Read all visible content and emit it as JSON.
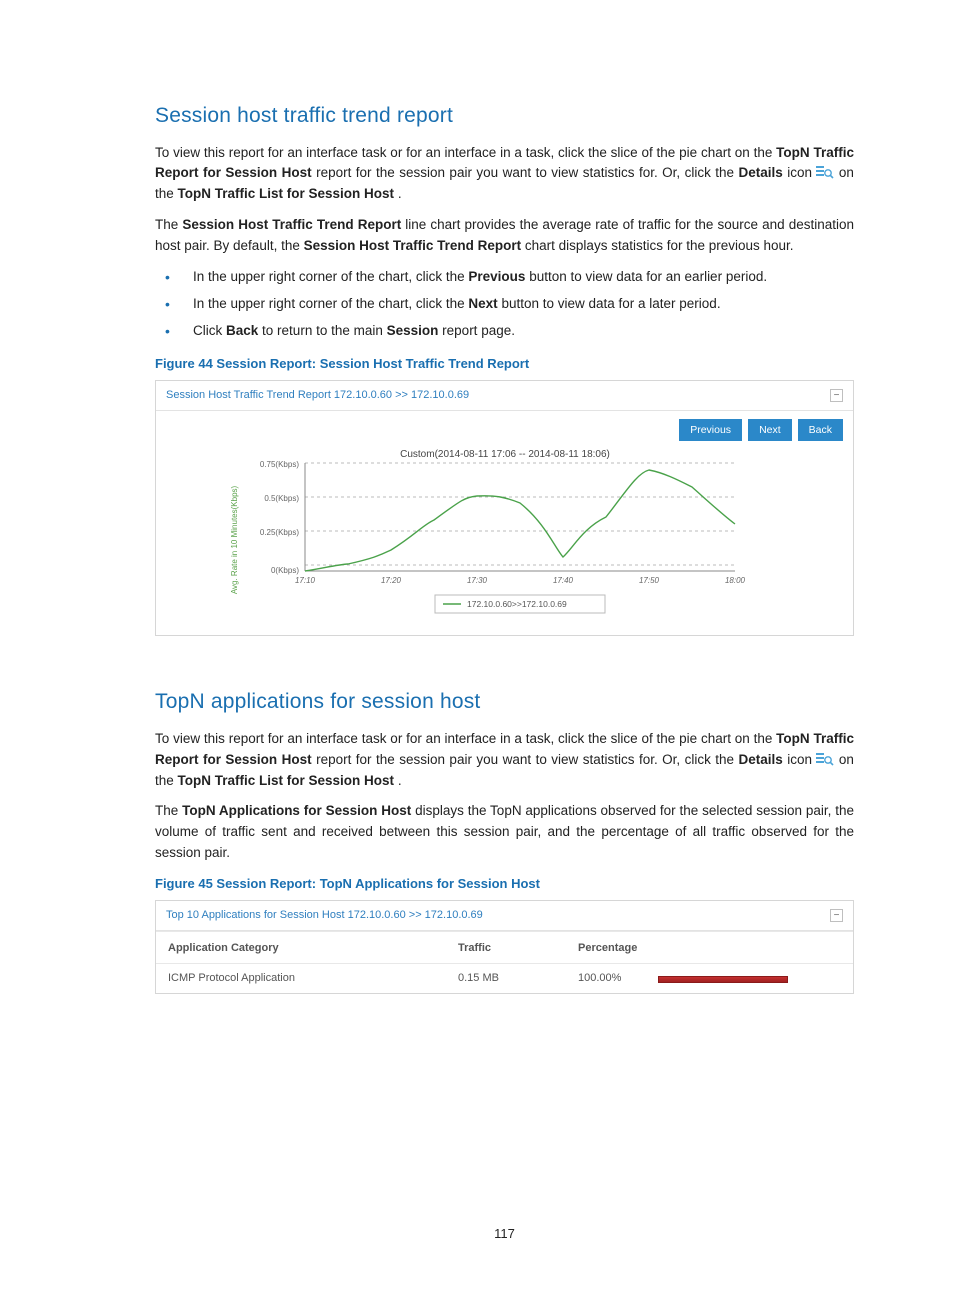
{
  "section1": {
    "heading": "Session host traffic trend report",
    "para1_parts": {
      "p1": "To view this report for an interface task or for an interface in a task, click the slice of the pie chart on the ",
      "b1": "TopN Traffic Report for Session Host",
      "p2": " report for the session pair you want to view statistics for. Or, click the ",
      "b2": "Details",
      "p3": " icon ",
      "p4": " on the ",
      "b3": "TopN Traffic List for Session Host",
      "p5": "."
    },
    "para2_parts": {
      "p1": "The ",
      "b1": "Session Host Traffic Trend Report",
      "p2": " line chart provides the average rate of traffic for the source and destination host pair. By default, the ",
      "b2": "Session Host Traffic Trend Report",
      "p3": " chart displays statistics for the previous hour."
    },
    "bullets": [
      {
        "pre": "In the upper right corner of the chart, click the ",
        "b": "Previous",
        "post": " button to view data for an earlier period."
      },
      {
        "pre": "In the upper right corner of the chart, click the ",
        "b": "Next",
        "post": " button to view data for a later period."
      },
      {
        "pre": "Click ",
        "b": "Back",
        "post": " to return to the main ",
        "b2": "Session",
        "post2": " report page."
      }
    ],
    "figure_caption": "Figure 44 Session Report: Session Host Traffic Trend Report"
  },
  "panel1": {
    "title": "Session Host Traffic Trend Report 172.10.0.60 >> 172.10.0.69",
    "buttons": {
      "previous": "Previous",
      "next": "Next",
      "back": "Back"
    },
    "chart_subtitle": "Custom(2014-08-11 17:06 -- 2014-08-11 18:06)",
    "legend": "172.10.0.60>>172.10.0.69",
    "y_axis_label": "Avg. Rate in 10 Minutes(Kbps)"
  },
  "chart_data": {
    "type": "line",
    "title": "Custom(2014-08-11 17:06 -- 2014-08-11 18:06)",
    "xlabel": "",
    "ylabel": "Avg. Rate in 10 Minutes(Kbps)",
    "ylim": [
      0,
      0.8
    ],
    "y_ticks": [
      "0(Kbps)",
      "0.25(Kbps)",
      "0.5(Kbps)",
      "0.75(Kbps)"
    ],
    "x_ticks": [
      "17:10",
      "17:20",
      "17:30",
      "17:40",
      "17:50",
      "18:00"
    ],
    "series": [
      {
        "name": "172.10.0.60>>172.10.0.69",
        "x": [
          "17:10",
          "17:15",
          "17:20",
          "17:25",
          "17:30",
          "17:35",
          "17:40",
          "17:45",
          "17:50",
          "17:55",
          "18:00"
        ],
        "values": [
          0.0,
          0.05,
          0.15,
          0.38,
          0.55,
          0.5,
          0.1,
          0.4,
          0.75,
          0.62,
          0.35
        ]
      }
    ]
  },
  "section2": {
    "heading": "TopN applications for session host",
    "para1_parts": {
      "p1": "To view this report for an interface task or for an interface in a task, click the slice of the pie chart on the ",
      "b1": "TopN Traffic Report for Session Host",
      "p2": " report for the session pair you want to view statistics for. Or, click the ",
      "b2": "Details",
      "p3": " icon ",
      "p4": " on the ",
      "b3": "TopN Traffic List for Session Host",
      "p5": "."
    },
    "para2_parts": {
      "p1": "The ",
      "b1": "TopN Applications for Session Host",
      "p2": " displays the TopN applications observed for the selected session pair, the volume of traffic sent and received between this session pair, and the percentage of all traffic observed for the session pair."
    },
    "figure_caption": "Figure 45 Session Report: TopN Applications for Session Host"
  },
  "panel2": {
    "title": "Top 10 Applications for Session Host 172.10.0.60 >> 172.10.0.69",
    "headers": {
      "app": "Application Category",
      "traffic": "Traffic",
      "pct": "Percentage"
    },
    "rows": [
      {
        "app": "ICMP Protocol Application",
        "traffic": "0.15 MB",
        "pct": "100.00%"
      }
    ]
  },
  "page_number": "117"
}
